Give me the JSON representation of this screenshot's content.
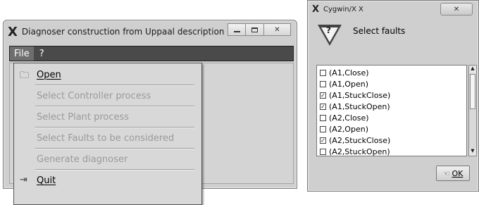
{
  "main_window": {
    "title": "Diagnoser construction from Uppaal description",
    "menubar": {
      "file": "File",
      "help": "?"
    },
    "file_menu": [
      {
        "label": "Open",
        "icon": "folder-icon",
        "enabled": true
      },
      {
        "label": "Select Controller process",
        "enabled": false
      },
      {
        "label": "Select Plant process",
        "enabled": false
      },
      {
        "label": "Select Faults to be considered",
        "enabled": false
      },
      {
        "label": "Generate diagnoser",
        "enabled": false
      },
      {
        "label": "Quit",
        "icon": "exit-icon",
        "enabled": true
      }
    ]
  },
  "dialog": {
    "title": "Cygwin/X X",
    "heading": "Select faults",
    "faults": [
      {
        "label": "(A1,Close)",
        "checked": false
      },
      {
        "label": "(A1,Open)",
        "checked": false
      },
      {
        "label": "(A1,StuckClose)",
        "checked": true
      },
      {
        "label": "(A1,StuckOpen)",
        "checked": true
      },
      {
        "label": "(A2,Close)",
        "checked": false
      },
      {
        "label": "(A2,Open)",
        "checked": false
      },
      {
        "label": "(A2,StuckClose)",
        "checked": true
      },
      {
        "label": "(A2,StuckOpen)",
        "checked": false
      }
    ],
    "ok_label": "OK"
  }
}
